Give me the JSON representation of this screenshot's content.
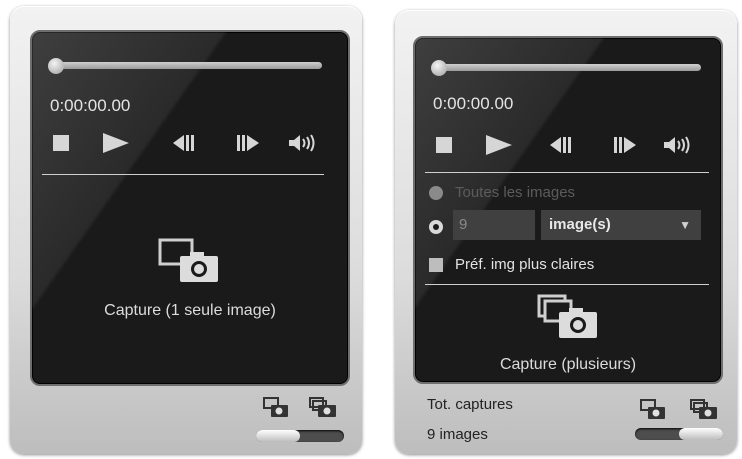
{
  "single_panel": {
    "time": "0:00:00.00",
    "capture_label": "Capture (1 seule image)",
    "mode_switch_level": 0.35
  },
  "multi_panel": {
    "time": "0:00:00.00",
    "option_all_images": "Toutes les images",
    "image_count_value": "9",
    "unit_select_value": "image(s)",
    "brighter_images_label": "Préf. img plus claires",
    "capture_label": "Capture (plusieurs)",
    "total_captures_label": "Tot. captures",
    "total_captures_value": "9 images",
    "mode_switch_level": 0.75
  }
}
